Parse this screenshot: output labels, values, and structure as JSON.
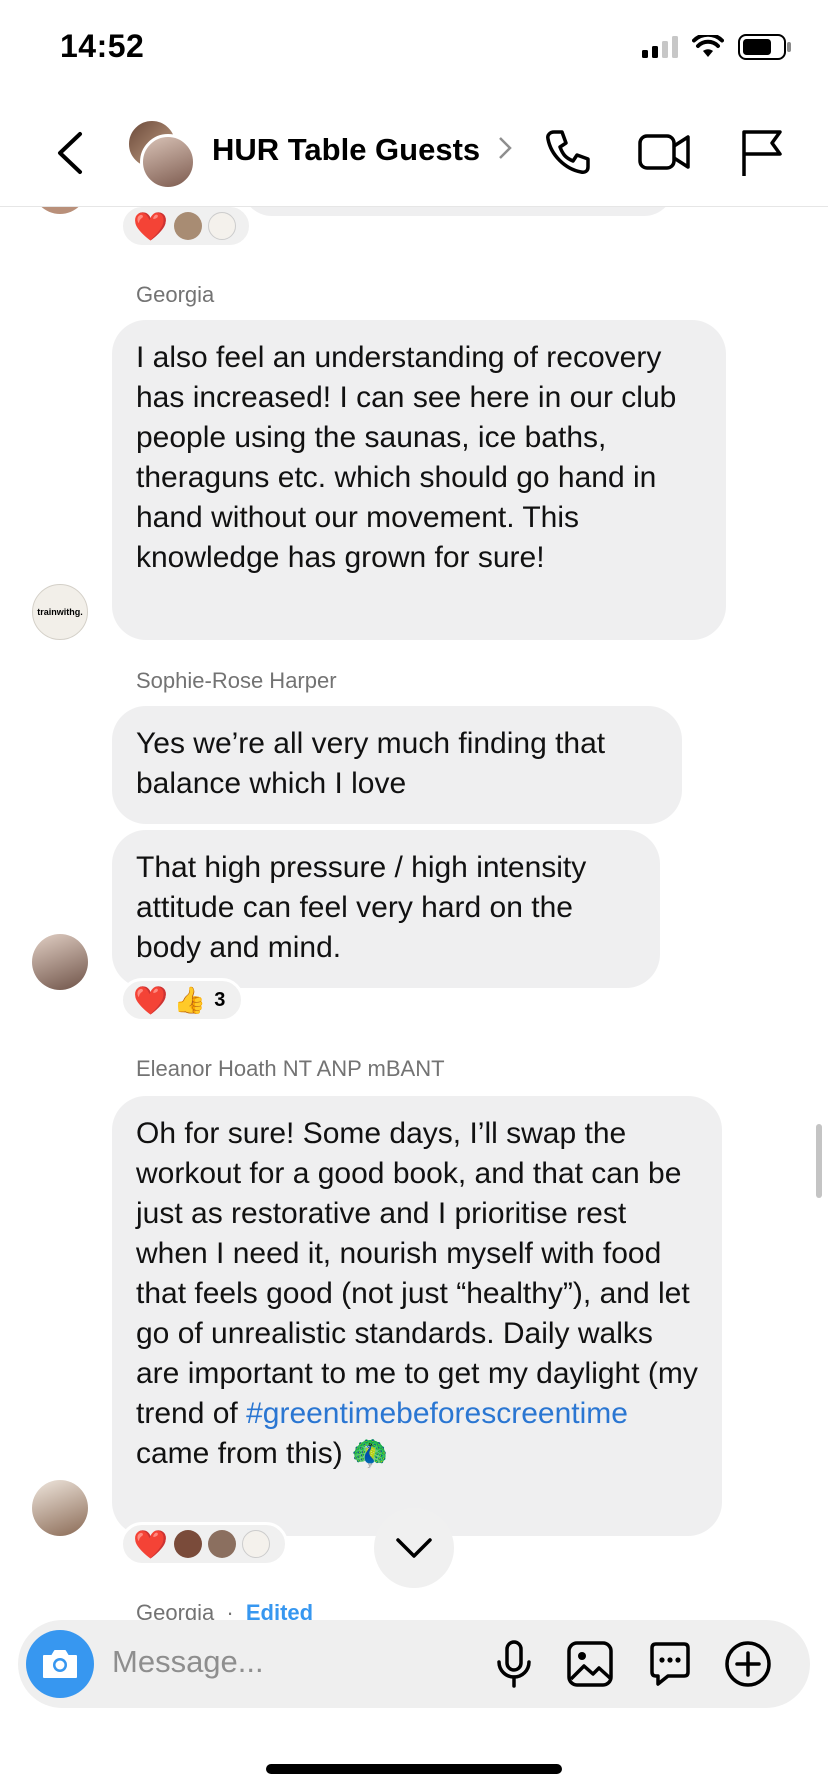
{
  "status": {
    "time": "14:52"
  },
  "header": {
    "title": "HUR Table Guests"
  },
  "reactions_top": {
    "heart": "❤️"
  },
  "messages": [
    {
      "sender": "Georgia",
      "text": "I also feel an understanding of recovery has increased! I can see here in our club people using the saunas, ice baths, theraguns etc. which should go hand in hand without our movement. This knowledge has grown for sure!",
      "avatar_text": "trainwithg."
    },
    {
      "sender": "Sophie-Rose Harper",
      "text1": "Yes we’re all very much finding that balance which I love",
      "text2": "That high pressure / high intensity attitude can feel very hard on the body and mind.",
      "reactions": {
        "heart": "❤️",
        "thumb": "👍",
        "count": "3"
      }
    },
    {
      "sender": "Eleanor Hoath NT ANP mBANT",
      "text_before": "Oh for sure! Some days, I’ll swap the workout for a good book, and that can be just as restorative and I prioritise rest when I need it, nourish myself with food that feels good (not just “healthy”), and let go of unrealistic standards. Daily walks are important to me to get my daylight (my trend of ",
      "hashtag": "#greentimebeforescreentime",
      "text_after": " came from this) 🦚",
      "reactions": {
        "heart": "❤️"
      }
    },
    {
      "sender": "Georgia",
      "separator": "·",
      "edited": "Edited"
    }
  ],
  "composer": {
    "placeholder": "Message..."
  },
  "colors": {
    "accent": "#3797f0",
    "bubble": "#efeff0",
    "hashtag": "#2a76d2"
  },
  "icons": [
    "back-icon",
    "chevron-right-icon",
    "phone-icon",
    "video-icon",
    "flag-icon",
    "chevron-down-icon",
    "camera-icon",
    "mic-icon",
    "gallery-icon",
    "sticker-icon",
    "plus-icon"
  ]
}
